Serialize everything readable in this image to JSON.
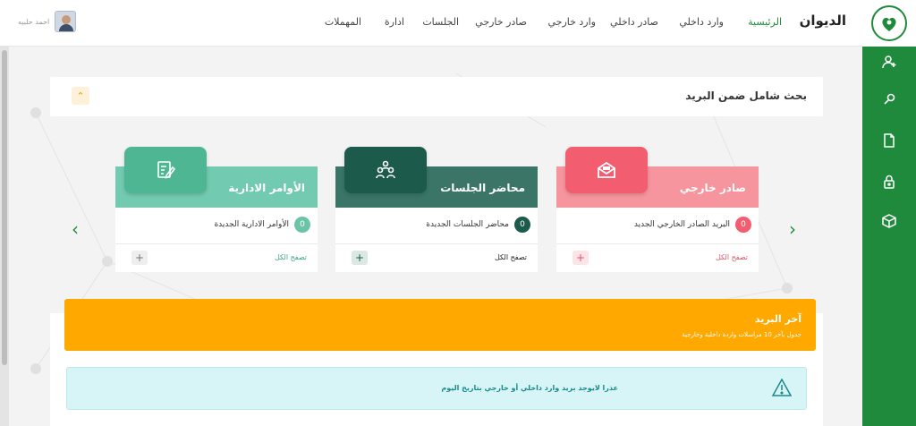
{
  "header": {
    "brand": "الديوان",
    "nav": [
      {
        "label": "الرئيسية",
        "active": true
      },
      {
        "label": "وارد داخلي"
      },
      {
        "label": "صادر داخلي"
      },
      {
        "label": "وارد خارجي"
      },
      {
        "label": "صادر خارجي"
      },
      {
        "label": "الجلسات"
      },
      {
        "label": "ادارة"
      },
      {
        "label": "المهملات"
      }
    ],
    "user_name": "احمد حلبيه"
  },
  "sidebar": {
    "icons": [
      "user-add-icon",
      "search-key-icon",
      "file-icon",
      "lock-icon",
      "box-icon"
    ]
  },
  "search": {
    "title": "بحث شامل ضمن البريد",
    "collapse_icon": "chevron-up-icon"
  },
  "cards": [
    {
      "title": "صادر خارجي",
      "item_label": "البريد الصادر الخارجي الجديد",
      "count": "0",
      "view_all": "تصفح الكل",
      "icon": "envelope-icon",
      "band_color": "#f7959e",
      "tile_color": "#f25e6f",
      "badge_color": "#f25e6f",
      "link_color": "#e05563"
    },
    {
      "title": "محاضر الجلسات",
      "item_label": "محاضر الجلسات الجديدة",
      "count": "0",
      "view_all": "تصفح الكل",
      "icon": "people-icon",
      "band_color": "#3a7568",
      "tile_color": "#1c5a4c",
      "badge_color": "#1c5a4c",
      "link_color": "#222222"
    },
    {
      "title": "الأوامر الادارية",
      "item_label": "الأوامر الادارية الجديدة",
      "count": "0",
      "view_all": "تصفح الكل",
      "icon": "edit-document-icon",
      "band_color": "#72cbb0",
      "tile_color": "#4fb694",
      "badge_color": "#6cc4a6",
      "link_color": "#3aa57f"
    }
  ],
  "latest_mail": {
    "title": "آخر البريد",
    "subtitle": "جدول بآخر 10 مراسلات واردة داخلية وخارجية"
  },
  "alert": {
    "text": "عذرا لايوجد بريد وارد داخلي أو خارجي بتاريخ اليوم",
    "icon": "warning-icon"
  },
  "colors": {
    "primary": "#1f8a3c",
    "warning": "#ffa800",
    "info_bg": "#d7f4f6"
  }
}
